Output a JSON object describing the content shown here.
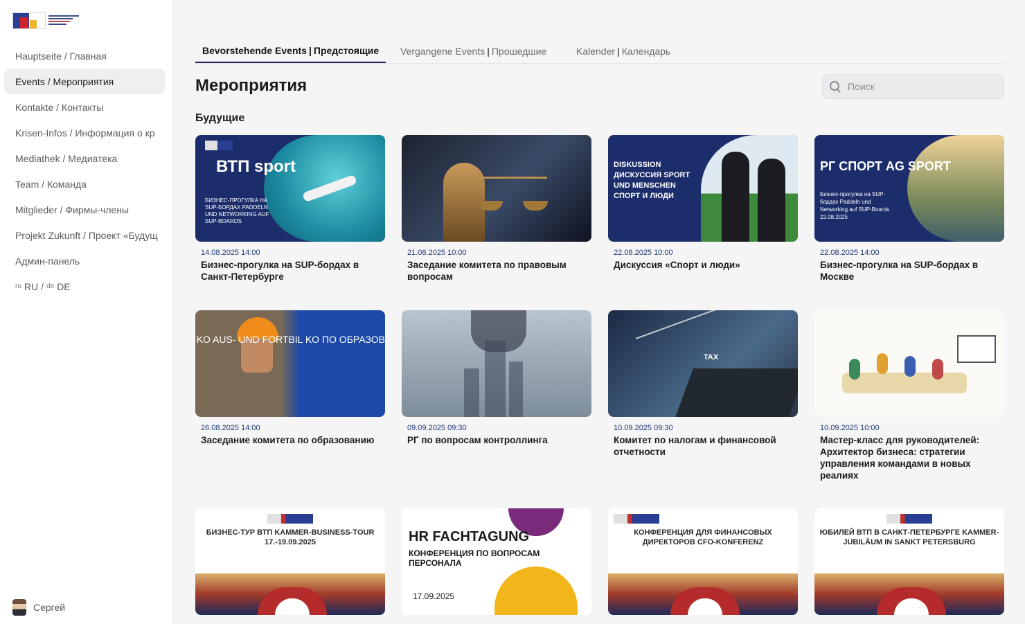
{
  "sidebar": {
    "nav": [
      {
        "label": "Hauptseite / Главная",
        "active": false
      },
      {
        "label": "Events / Мероприятия",
        "active": true
      },
      {
        "label": "Kontakte / Контакты",
        "active": false
      },
      {
        "label": "Krisen-Infos / Информация о кр",
        "active": false
      },
      {
        "label": "Mediathek / Медиатека",
        "active": false
      },
      {
        "label": "Team / Команда",
        "active": false
      },
      {
        "label": "Mitglieder / Фирмы-члены",
        "active": false
      },
      {
        "label": "Projekt Zukunft / Проект «Будущ",
        "active": false
      },
      {
        "label": "Админ-панель",
        "active": false
      }
    ],
    "lang": {
      "ru_code": "RU",
      "ru": "RU",
      "sep": "/",
      "de_code": "DE",
      "de": "DE"
    },
    "user": {
      "name": "Сергей"
    }
  },
  "tabs": [
    {
      "de": "Bevorstehende Events",
      "ru": "Предстоящие",
      "active": true
    },
    {
      "de": "Vergangene Events",
      "ru": "Прошедшие",
      "active": false
    },
    {
      "de": "Kalender",
      "ru": "Календарь",
      "active": false
    }
  ],
  "page": {
    "title": "Мероприятия",
    "section": "Будущие",
    "search_placeholder": "Поиск"
  },
  "events": [
    {
      "date": "14.08.2025 14:00",
      "title": "Бизнес-прогулка на SUP-бордах в Санкт-Петербурге",
      "thumb": {
        "big": "ВТП sport",
        "small": "БИЗНЕС-ПРОГУЛКА НА SUP-БОРДАХ PADDELN UND NETWORKING AUF SUP-BOARDS"
      }
    },
    {
      "date": "21.08.2025 10:00",
      "title": "Заседание комитета по правовым вопросам",
      "thumb": {}
    },
    {
      "date": "22.08.2025 10:00",
      "title": "Дискуссия «Спорт и люди»",
      "thumb": {
        "text": "DISKUSSION ДИСКУССИЯ SPORT UND MENSCHEN СПОРТ И ЛЮДИ"
      }
    },
    {
      "date": "22.08.2025 14:00",
      "title": "Бизнес-прогулка на SUP-бордах в Москве",
      "thumb": {
        "big": "РГ СПОРТ AG SPORT",
        "small": "Бизнес-прогулка на SUP-бордах Paddeln und Networking auf SUP-Boards 22.08.2025"
      }
    },
    {
      "date": "26.08.2025 14:00",
      "title": "Заседание комитета по образованию",
      "thumb": {
        "text": "KO AUS- UND FORTBIL KO ПО ОБРАЗОВ"
      }
    },
    {
      "date": "09.09.2025 09:30",
      "title": "РГ по вопросам контроллинга",
      "thumb": {}
    },
    {
      "date": "10.09.2025 09:30",
      "title": "Комитет по налогам и финансовой отчетности",
      "thumb": {
        "text": "TAX"
      }
    },
    {
      "date": "10.09.2025 10:00",
      "title": "Мастер-класс для руководителей: Архитектор бизнеса: стратегии управления командами в новых реалиях",
      "thumb": {}
    },
    {
      "date": "",
      "title": "",
      "thumb": {
        "head": "БИЗНЕС-ТУР ВТП KAMMER-BUSINESS-TOUR 17.-19.09.2025"
      }
    },
    {
      "date": "",
      "title": "",
      "thumb": {
        "hr": "HR FACHTAGUNG",
        "sub": "КОНФЕРЕНЦИЯ ПО ВОПРОСАМ ПЕРСОНАЛА",
        "date": "17.09.2025"
      }
    },
    {
      "date": "",
      "title": "",
      "thumb": {
        "head": "КОНФЕРЕНЦИЯ ДЛЯ ФИНАНСОВЫХ ДИРЕКТОРОВ CFO-KONFERENZ"
      }
    },
    {
      "date": "",
      "title": "",
      "thumb": {
        "head": "ЮБИЛЕЙ ВТП В САНКТ-ПЕТЕРБУРГЕ KAMMER-JUBILÄUM IN SANKT PETERSBURG"
      }
    }
  ]
}
